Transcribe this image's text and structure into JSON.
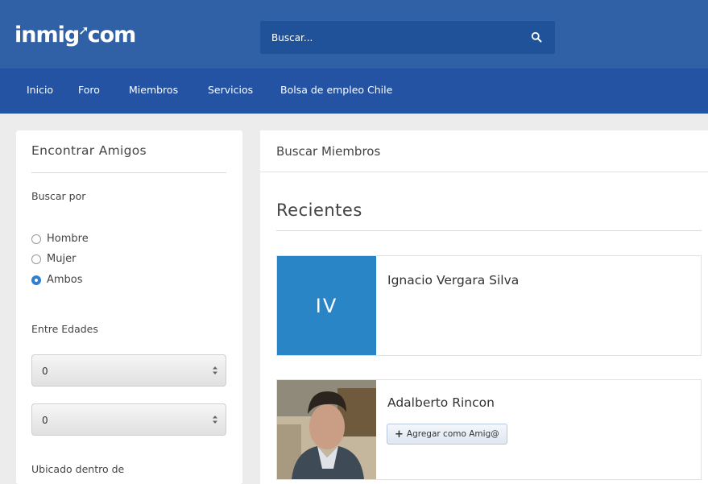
{
  "header": {
    "logo_text_a": "inmig",
    "logo_text_b": "com",
    "search_placeholder": "Buscar..."
  },
  "nav": {
    "items": [
      {
        "label": "Inicio"
      },
      {
        "label": "Foro"
      },
      {
        "label": "Miembros"
      },
      {
        "label": "Servicios"
      },
      {
        "label": "Bolsa de empleo Chile"
      }
    ]
  },
  "sidebar": {
    "title": "Encontrar Amigos",
    "search_by_label": "Buscar por",
    "gender_options": [
      {
        "label": "Hombre",
        "checked": false
      },
      {
        "label": "Mujer",
        "checked": false
      },
      {
        "label": "Ambos",
        "checked": true
      }
    ],
    "age_label": "Entre Edades",
    "age_min": "0",
    "age_max": "0",
    "located_label": "Ubicado dentro de"
  },
  "main": {
    "header": "Buscar Miembros",
    "section_title": "Recientes",
    "members": [
      {
        "name": "Ignacio Vergara Silva",
        "initials": "IV"
      },
      {
        "name": "Adalberto Rincon",
        "add_button": "Agregar como Amig@"
      }
    ]
  },
  "colors": {
    "topbar": "#3061a7",
    "navbar": "#2553a3",
    "avatar_bg": "#2a85c7",
    "radio_checked": "#2f7fd1"
  }
}
